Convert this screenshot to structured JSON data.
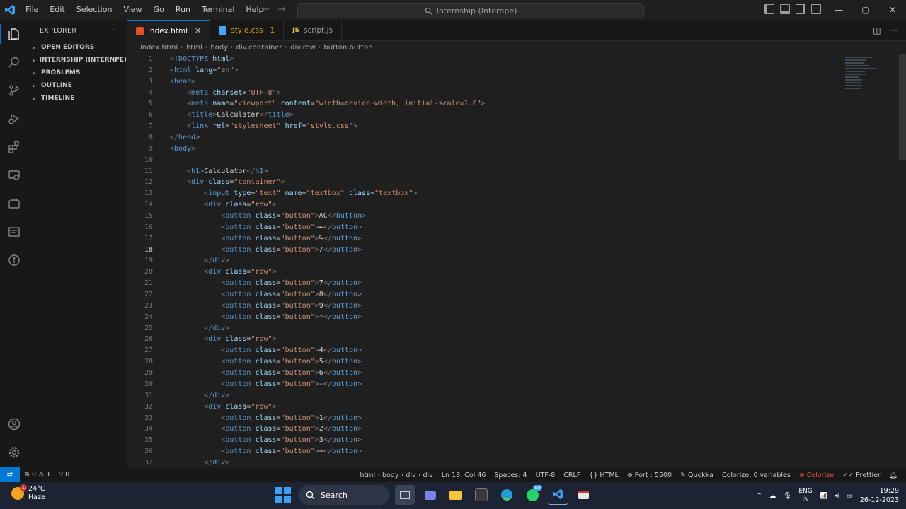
{
  "window": {
    "menu": [
      "File",
      "Edit",
      "Selection",
      "View",
      "Go",
      "Run",
      "Terminal",
      "Help"
    ],
    "command_center": "Internship (Internpe)",
    "controls": {
      "minimize": "—",
      "maximize": "▢",
      "close": "✕"
    }
  },
  "sidebar": {
    "title": "EXPLORER",
    "more": "···",
    "sections": [
      "OPEN EDITORS",
      "INTERNSHIP (INTERNPE)",
      "PROBLEMS",
      "OUTLINE",
      "TIMELINE"
    ]
  },
  "tabs": [
    {
      "label": "index.html",
      "active": true,
      "close": "✕"
    },
    {
      "label": "style.css",
      "badge": "1"
    },
    {
      "label": "script.js",
      "icon_text": "JS"
    }
  ],
  "breadcrumbs": [
    "index.html",
    "html",
    "body",
    "div.container",
    "div.row",
    "button.button"
  ],
  "editor": {
    "current_line": 18,
    "lines": [
      {
        "n": 1,
        "indent": 0,
        "text": "<!DOCTYPE html>"
      },
      {
        "n": 2,
        "indent": 0,
        "text": "<html lang=\"en\">"
      },
      {
        "n": 3,
        "indent": 0,
        "text": "<head>"
      },
      {
        "n": 4,
        "indent": 4,
        "text": "<meta charset=\"UTF-8\">"
      },
      {
        "n": 5,
        "indent": 4,
        "text": "<meta name=\"viewport\" content=\"width=device-width, initial-scale=1.0\">"
      },
      {
        "n": 6,
        "indent": 4,
        "text": "<title>Calculator</title>"
      },
      {
        "n": 7,
        "indent": 4,
        "text": "<link rel=\"stylesheet\" href=\"style.css\">"
      },
      {
        "n": 8,
        "indent": 0,
        "text": "</head>"
      },
      {
        "n": 9,
        "indent": 0,
        "text": "<body>"
      },
      {
        "n": 10,
        "indent": 0,
        "text": ""
      },
      {
        "n": 11,
        "indent": 4,
        "text": "<h1>Calculator</h1>"
      },
      {
        "n": 12,
        "indent": 4,
        "text": "<div class=\"container\">"
      },
      {
        "n": 13,
        "indent": 8,
        "text": "<input type=\"text\" name=\"textbox\" class=\"textbox\">"
      },
      {
        "n": 14,
        "indent": 8,
        "text": "<div class=\"row\">"
      },
      {
        "n": 15,
        "indent": 12,
        "text": "<button class=\"button\">AC</button>"
      },
      {
        "n": 16,
        "indent": 12,
        "text": "<button class=\"button\">←</button>"
      },
      {
        "n": 17,
        "indent": 12,
        "text": "<button class=\"button\">%</button>"
      },
      {
        "n": 18,
        "indent": 12,
        "text": "<button class=\"button\">/</button>"
      },
      {
        "n": 19,
        "indent": 8,
        "text": "</div>"
      },
      {
        "n": 20,
        "indent": 8,
        "text": "<div class=\"row\">"
      },
      {
        "n": 21,
        "indent": 12,
        "text": "<button class=\"button\">7</button>"
      },
      {
        "n": 22,
        "indent": 12,
        "text": "<button class=\"button\">8</button>"
      },
      {
        "n": 23,
        "indent": 12,
        "text": "<button class=\"button\">9</button>"
      },
      {
        "n": 24,
        "indent": 12,
        "text": "<button class=\"button\">*</button>"
      },
      {
        "n": 25,
        "indent": 8,
        "text": "</div>"
      },
      {
        "n": 26,
        "indent": 8,
        "text": "<div class=\"row\">"
      },
      {
        "n": 27,
        "indent": 12,
        "text": "<button class=\"button\">4</button>"
      },
      {
        "n": 28,
        "indent": 12,
        "text": "<button class=\"button\">5</button>"
      },
      {
        "n": 29,
        "indent": 12,
        "text": "<button class=\"button\">6</button>"
      },
      {
        "n": 30,
        "indent": 12,
        "text": "<button class=\"button\">-</button>"
      },
      {
        "n": 31,
        "indent": 8,
        "text": "</div>"
      },
      {
        "n": 32,
        "indent": 8,
        "text": "<div class=\"row\">"
      },
      {
        "n": 33,
        "indent": 12,
        "text": "<button class=\"button\">1</button>"
      },
      {
        "n": 34,
        "indent": 12,
        "text": "<button class=\"button\">2</button>"
      },
      {
        "n": 35,
        "indent": 12,
        "text": "<button class=\"button\">3</button>"
      },
      {
        "n": 36,
        "indent": 12,
        "text": "<button class=\"button\">+</button>"
      },
      {
        "n": 37,
        "indent": 8,
        "text": "</div>"
      }
    ]
  },
  "statusbar": {
    "errors": "0",
    "warnings": "1",
    "ports_count": "0",
    "path": "html › body › div › div",
    "position": "Ln 18, Col 46",
    "spaces": "Spaces: 4",
    "encoding": "UTF-8",
    "eol": "CRLF",
    "language": "HTML",
    "port": "Port : 5500",
    "quokka": "Quokka",
    "colorize_vars": "Colorize: 0 variables",
    "colorize": "Colorize",
    "prettier": "Prettier"
  },
  "taskbar": {
    "temperature": "24°C",
    "weather": "Haze",
    "weather_badge": "1",
    "search_label": "Search",
    "whatsapp_badge": "90",
    "language_top": "ENG",
    "language_bottom": "IN",
    "time": "19:29",
    "date": "26-12-2023"
  },
  "colors": {
    "accent": "#0078d4",
    "keyword": "#569cd6",
    "attribute": "#9cdcfe",
    "string": "#ce9178",
    "error": "#f14c4c"
  }
}
